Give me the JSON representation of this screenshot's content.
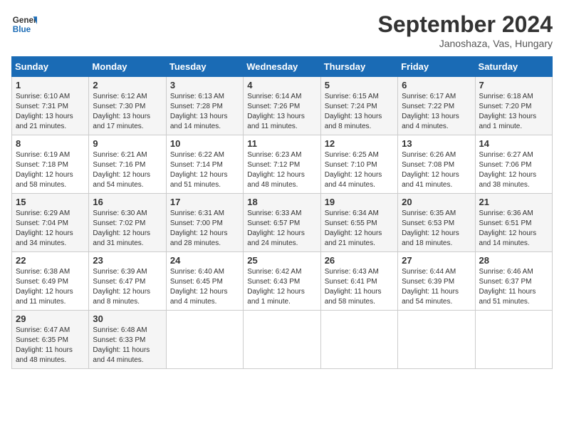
{
  "header": {
    "logo_line1": "General",
    "logo_line2": "Blue",
    "month": "September 2024",
    "location": "Janoshaza, Vas, Hungary"
  },
  "weekdays": [
    "Sunday",
    "Monday",
    "Tuesday",
    "Wednesday",
    "Thursday",
    "Friday",
    "Saturday"
  ],
  "weeks": [
    [
      {
        "day": "1",
        "info": "Sunrise: 6:10 AM\nSunset: 7:31 PM\nDaylight: 13 hours\nand 21 minutes."
      },
      {
        "day": "2",
        "info": "Sunrise: 6:12 AM\nSunset: 7:30 PM\nDaylight: 13 hours\nand 17 minutes."
      },
      {
        "day": "3",
        "info": "Sunrise: 6:13 AM\nSunset: 7:28 PM\nDaylight: 13 hours\nand 14 minutes."
      },
      {
        "day": "4",
        "info": "Sunrise: 6:14 AM\nSunset: 7:26 PM\nDaylight: 13 hours\nand 11 minutes."
      },
      {
        "day": "5",
        "info": "Sunrise: 6:15 AM\nSunset: 7:24 PM\nDaylight: 13 hours\nand 8 minutes."
      },
      {
        "day": "6",
        "info": "Sunrise: 6:17 AM\nSunset: 7:22 PM\nDaylight: 13 hours\nand 4 minutes."
      },
      {
        "day": "7",
        "info": "Sunrise: 6:18 AM\nSunset: 7:20 PM\nDaylight: 13 hours\nand 1 minute."
      }
    ],
    [
      {
        "day": "8",
        "info": "Sunrise: 6:19 AM\nSunset: 7:18 PM\nDaylight: 12 hours\nand 58 minutes."
      },
      {
        "day": "9",
        "info": "Sunrise: 6:21 AM\nSunset: 7:16 PM\nDaylight: 12 hours\nand 54 minutes."
      },
      {
        "day": "10",
        "info": "Sunrise: 6:22 AM\nSunset: 7:14 PM\nDaylight: 12 hours\nand 51 minutes."
      },
      {
        "day": "11",
        "info": "Sunrise: 6:23 AM\nSunset: 7:12 PM\nDaylight: 12 hours\nand 48 minutes."
      },
      {
        "day": "12",
        "info": "Sunrise: 6:25 AM\nSunset: 7:10 PM\nDaylight: 12 hours\nand 44 minutes."
      },
      {
        "day": "13",
        "info": "Sunrise: 6:26 AM\nSunset: 7:08 PM\nDaylight: 12 hours\nand 41 minutes."
      },
      {
        "day": "14",
        "info": "Sunrise: 6:27 AM\nSunset: 7:06 PM\nDaylight: 12 hours\nand 38 minutes."
      }
    ],
    [
      {
        "day": "15",
        "info": "Sunrise: 6:29 AM\nSunset: 7:04 PM\nDaylight: 12 hours\nand 34 minutes."
      },
      {
        "day": "16",
        "info": "Sunrise: 6:30 AM\nSunset: 7:02 PM\nDaylight: 12 hours\nand 31 minutes."
      },
      {
        "day": "17",
        "info": "Sunrise: 6:31 AM\nSunset: 7:00 PM\nDaylight: 12 hours\nand 28 minutes."
      },
      {
        "day": "18",
        "info": "Sunrise: 6:33 AM\nSunset: 6:57 PM\nDaylight: 12 hours\nand 24 minutes."
      },
      {
        "day": "19",
        "info": "Sunrise: 6:34 AM\nSunset: 6:55 PM\nDaylight: 12 hours\nand 21 minutes."
      },
      {
        "day": "20",
        "info": "Sunrise: 6:35 AM\nSunset: 6:53 PM\nDaylight: 12 hours\nand 18 minutes."
      },
      {
        "day": "21",
        "info": "Sunrise: 6:36 AM\nSunset: 6:51 PM\nDaylight: 12 hours\nand 14 minutes."
      }
    ],
    [
      {
        "day": "22",
        "info": "Sunrise: 6:38 AM\nSunset: 6:49 PM\nDaylight: 12 hours\nand 11 minutes."
      },
      {
        "day": "23",
        "info": "Sunrise: 6:39 AM\nSunset: 6:47 PM\nDaylight: 12 hours\nand 8 minutes."
      },
      {
        "day": "24",
        "info": "Sunrise: 6:40 AM\nSunset: 6:45 PM\nDaylight: 12 hours\nand 4 minutes."
      },
      {
        "day": "25",
        "info": "Sunrise: 6:42 AM\nSunset: 6:43 PM\nDaylight: 12 hours\nand 1 minute."
      },
      {
        "day": "26",
        "info": "Sunrise: 6:43 AM\nSunset: 6:41 PM\nDaylight: 11 hours\nand 58 minutes."
      },
      {
        "day": "27",
        "info": "Sunrise: 6:44 AM\nSunset: 6:39 PM\nDaylight: 11 hours\nand 54 minutes."
      },
      {
        "day": "28",
        "info": "Sunrise: 6:46 AM\nSunset: 6:37 PM\nDaylight: 11 hours\nand 51 minutes."
      }
    ],
    [
      {
        "day": "29",
        "info": "Sunrise: 6:47 AM\nSunset: 6:35 PM\nDaylight: 11 hours\nand 48 minutes."
      },
      {
        "day": "30",
        "info": "Sunrise: 6:48 AM\nSunset: 6:33 PM\nDaylight: 11 hours\nand 44 minutes."
      },
      {
        "day": "",
        "info": ""
      },
      {
        "day": "",
        "info": ""
      },
      {
        "day": "",
        "info": ""
      },
      {
        "day": "",
        "info": ""
      },
      {
        "day": "",
        "info": ""
      }
    ]
  ]
}
